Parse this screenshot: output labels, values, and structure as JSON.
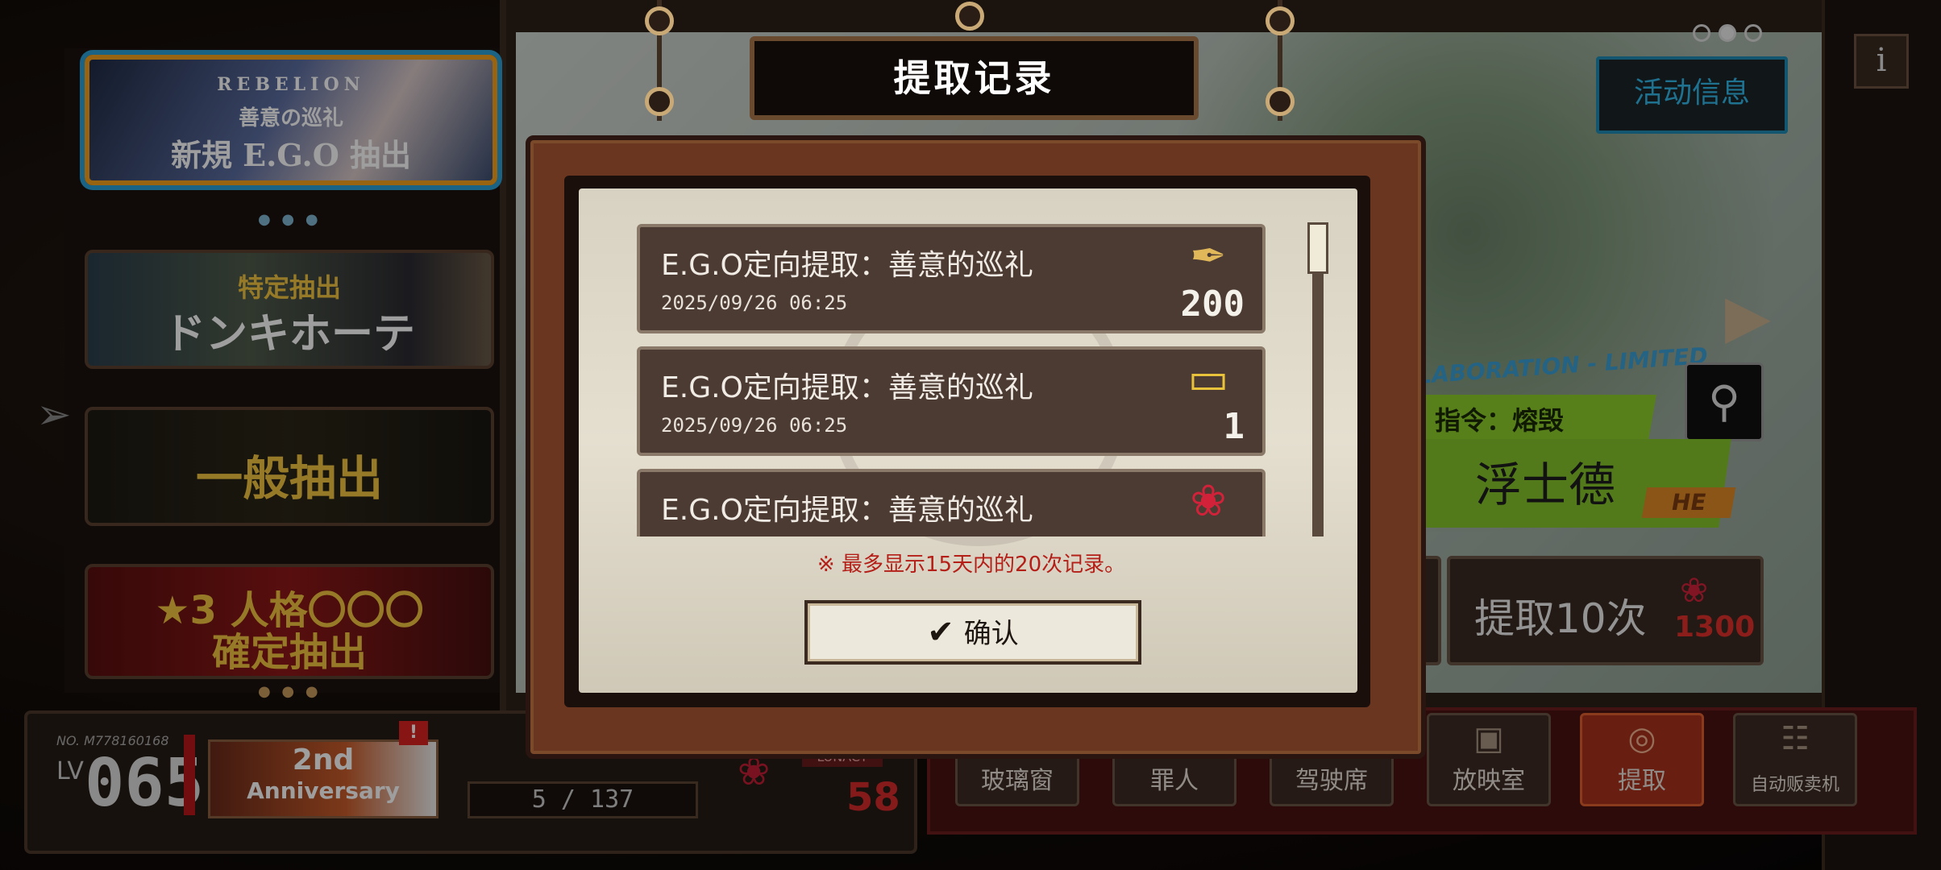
{
  "banners": {
    "ego_banner": {
      "line1": "REBELION",
      "line2": "善意の巡礼",
      "line3": "新規 E.G.O 抽出"
    },
    "specific": {
      "line1": "特定抽出",
      "line2": "ドンキホーテ"
    },
    "general": {
      "line1": "一般抽出"
    },
    "guaranteed": {
      "line1": "★3 人格〇〇〇",
      "line2": "確定抽出"
    }
  },
  "top": {
    "event_info_label": "活动信息",
    "info_icon": "i"
  },
  "featured": {
    "collab_text": "LLABORATION - LIMITED",
    "command_label": "指令：熔毁",
    "character_name": "浮士德",
    "rarity_tag": "HE",
    "pull10_label": "提取10次",
    "pull10_cost": "1300"
  },
  "nav": [
    {
      "label": "玻璃窗",
      "icon": "window-icon"
    },
    {
      "label": "罪人",
      "icon": "sinner-icon"
    },
    {
      "label": "驾驶席",
      "icon": "seat-icon"
    },
    {
      "label": "放映室",
      "icon": "projector-icon"
    },
    {
      "label": "提取",
      "icon": "extract-icon",
      "active": true
    },
    {
      "label": "自动贩卖机",
      "icon": "vending-icon"
    }
  ],
  "player": {
    "number": "NO. M778160168",
    "lv_label": "LV",
    "level": "065",
    "anniversary_line1": "2nd",
    "anniversary_line2": "Anniversary",
    "alert": "!",
    "stamina": "5 / 137",
    "lunacy_tag": "LUNACY",
    "roses": "58"
  },
  "modal": {
    "title": "提取记录",
    "records": [
      {
        "title": "E.G.O定向提取：善意的巡礼",
        "date": "2025/09/26 06:25",
        "item_icon": "feather-icon",
        "quantity": "200"
      },
      {
        "title": "E.G.O定向提取：善意的巡礼",
        "date": "2025/09/26 06:25",
        "item_icon": "ticket-icon",
        "quantity": "1"
      },
      {
        "title": "E.G.O定向提取：善意的巡礼",
        "date": "",
        "item_icon": "rose-icon",
        "quantity": ""
      }
    ],
    "notice": "※ 最多显示15天内的20次记录。",
    "confirm_label": "确认"
  },
  "colors": {
    "accent_blue": "#2aa0d5",
    "alert_red": "#d8231f",
    "lime": "#86c62b",
    "notice_red": "#b41f18"
  }
}
